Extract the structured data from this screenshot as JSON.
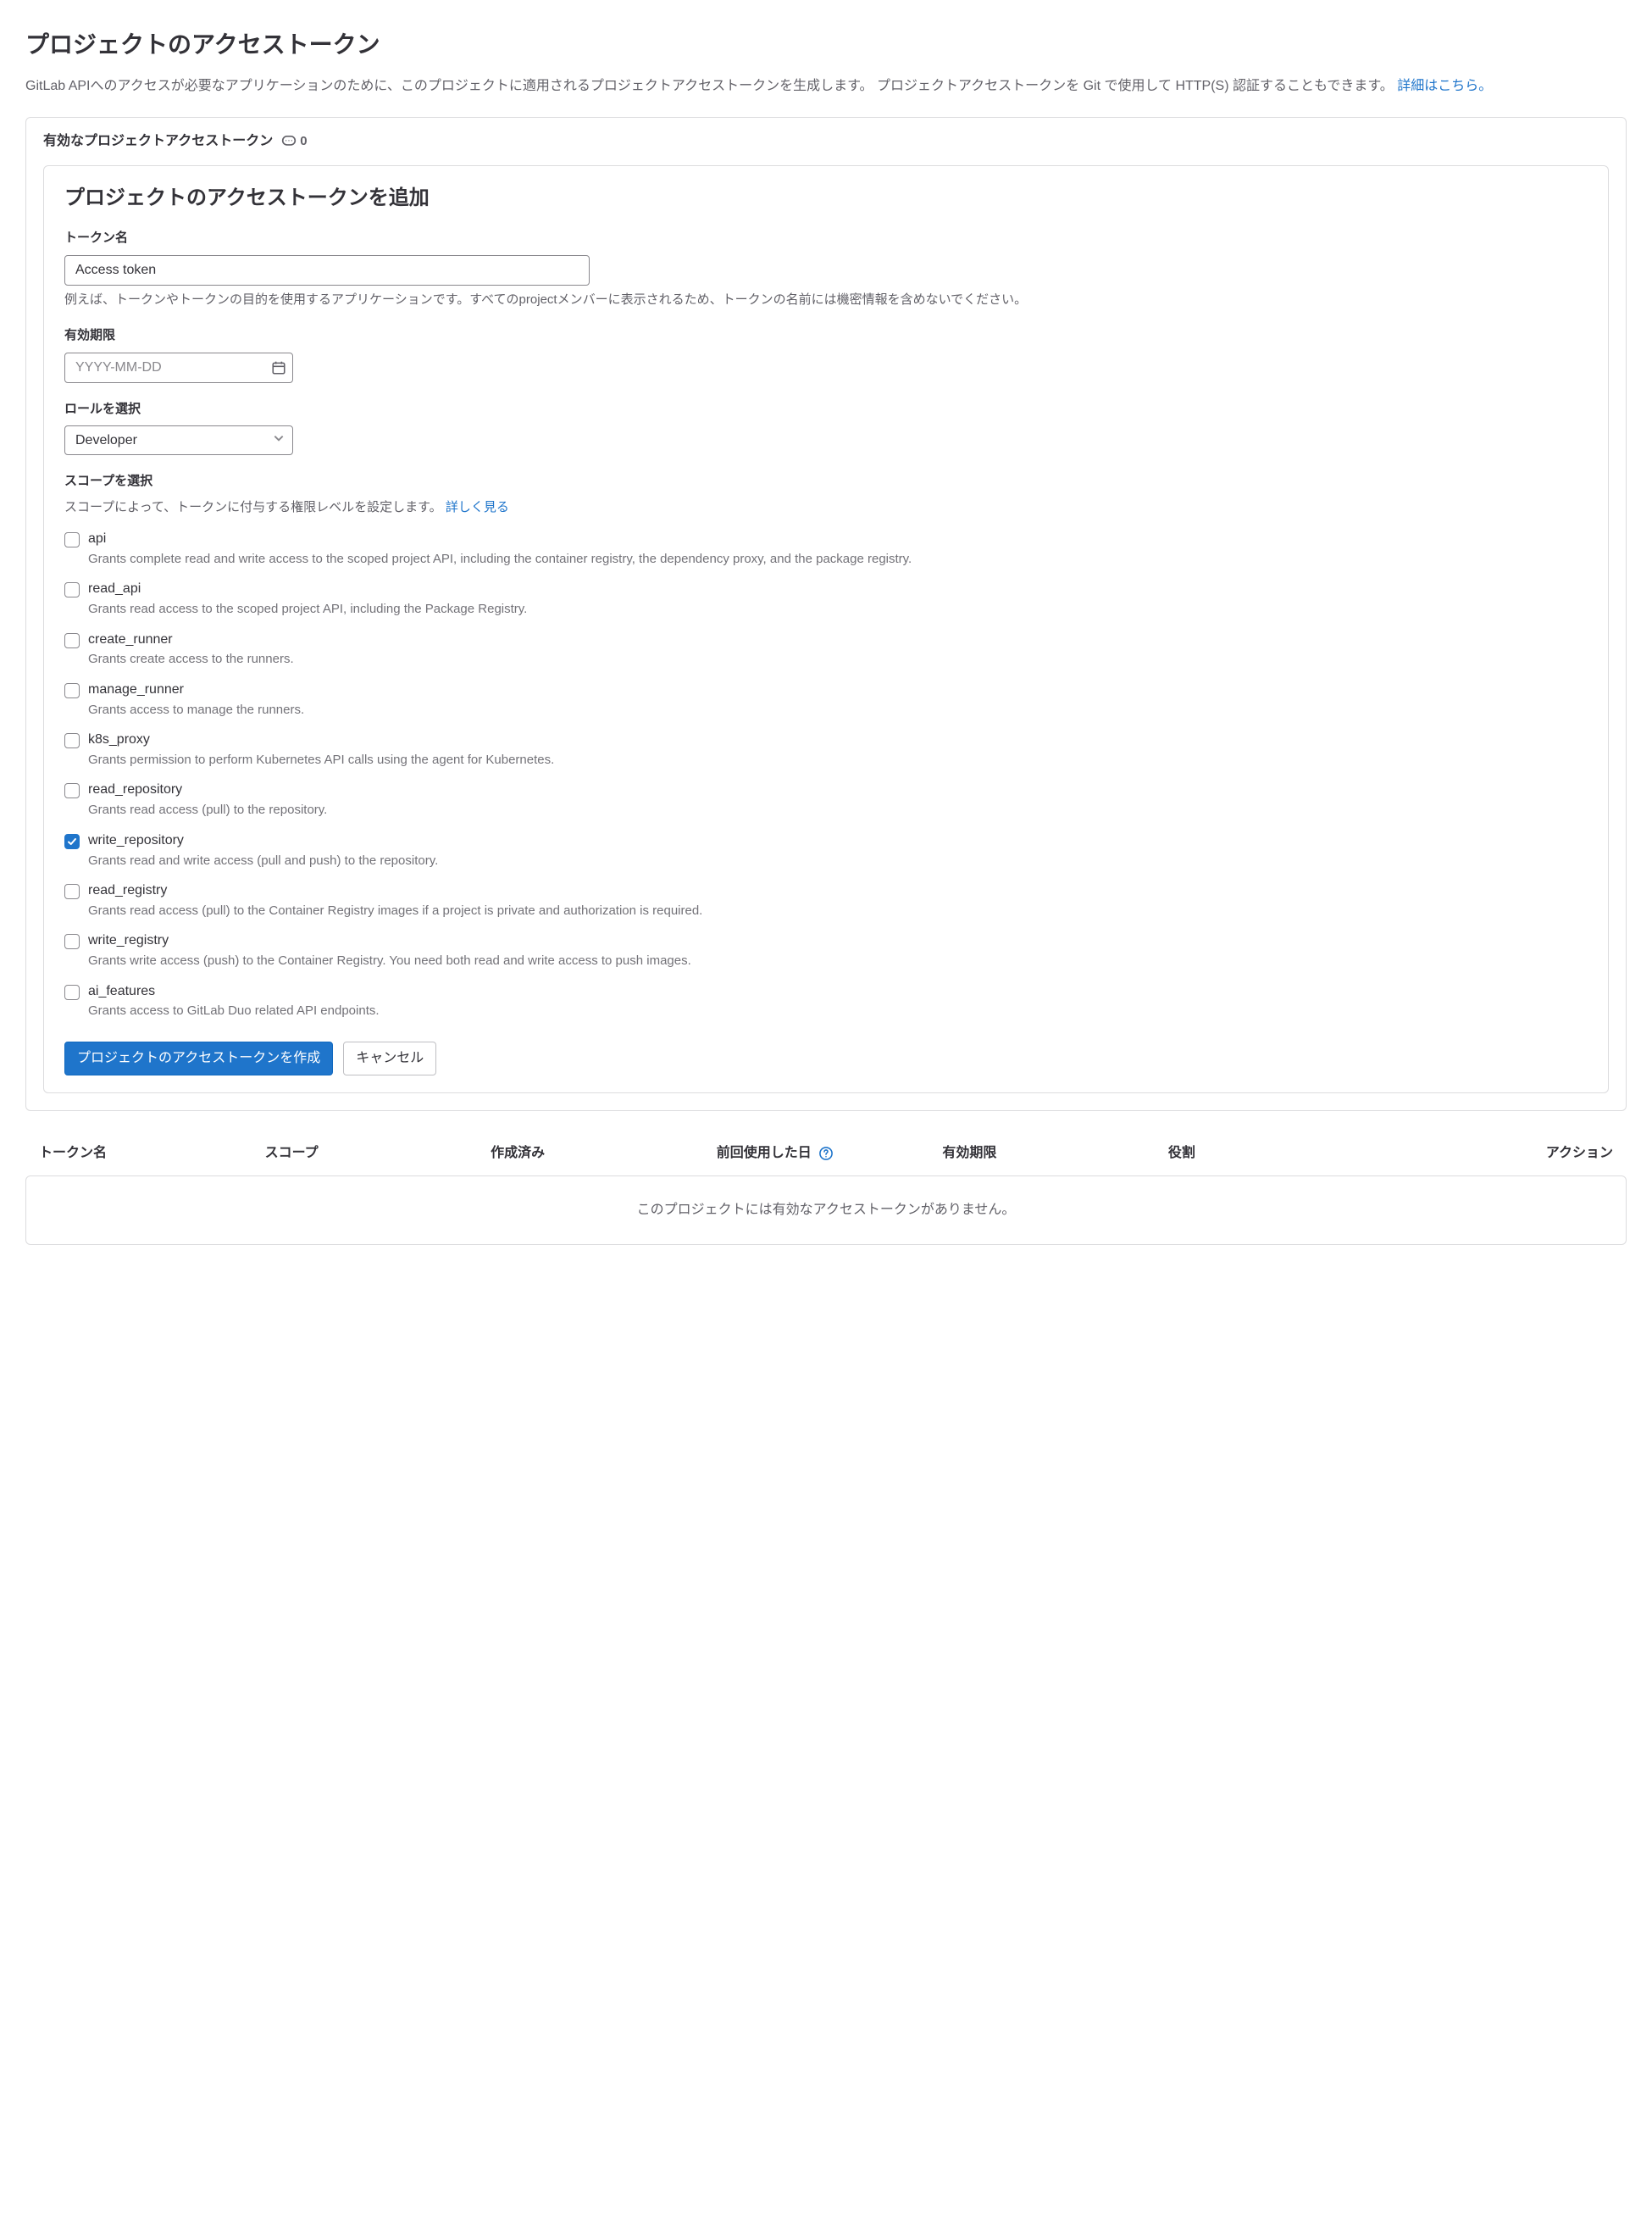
{
  "header": {
    "title": "プロジェクトのアクセストークン",
    "description_prefix": "GitLab APIへのアクセスが必要なアプリケーションのために、このプロジェクトに適用されるプロジェクトアクセストークンを生成します。 プロジェクトアクセストークンを Git で使用して HTTP(S) 認証することもできます。",
    "learn_more": "詳細はこちら。"
  },
  "active_tokens": {
    "title": "有効なプロジェクトアクセストークン",
    "count": "0"
  },
  "form": {
    "title": "プロジェクトのアクセストークンを追加",
    "name_label": "トークン名",
    "name_value": "Access token",
    "name_help": "例えば、トークンやトークンの目的を使用するアプリケーションです。すべてのprojectメンバーに表示されるため、トークンの名前には機密情報を含めないでください。",
    "expires_label": "有効期限",
    "expires_placeholder": "YYYY-MM-DD",
    "role_label": "ロールを選択",
    "role_value": "Developer",
    "scopes_label": "スコープを選択",
    "scopes_help_prefix": "スコープによって、トークンに付与する権限レベルを設定します。 ",
    "scopes_help_link": "詳しく見る",
    "scopes": [
      {
        "name": "api",
        "desc": "Grants complete read and write access to the scoped project API, including the container registry, the dependency proxy, and the package registry.",
        "checked": false
      },
      {
        "name": "read_api",
        "desc": "Grants read access to the scoped project API, including the Package Registry.",
        "checked": false
      },
      {
        "name": "create_runner",
        "desc": "Grants create access to the runners.",
        "checked": false
      },
      {
        "name": "manage_runner",
        "desc": "Grants access to manage the runners.",
        "checked": false
      },
      {
        "name": "k8s_proxy",
        "desc": "Grants permission to perform Kubernetes API calls using the agent for Kubernetes.",
        "checked": false
      },
      {
        "name": "read_repository",
        "desc": "Grants read access (pull) to the repository.",
        "checked": false
      },
      {
        "name": "write_repository",
        "desc": "Grants read and write access (pull and push) to the repository.",
        "checked": true
      },
      {
        "name": "read_registry",
        "desc": "Grants read access (pull) to the Container Registry images if a project is private and authorization is required.",
        "checked": false
      },
      {
        "name": "write_registry",
        "desc": "Grants write access (push) to the Container Registry. You need both read and write access to push images.",
        "checked": false
      },
      {
        "name": "ai_features",
        "desc": "Grants access to GitLab Duo related API endpoints.",
        "checked": false
      }
    ],
    "submit_label": "プロジェクトのアクセストークンを作成",
    "cancel_label": "キャンセル"
  },
  "table": {
    "columns": {
      "name": "トークン名",
      "scopes": "スコープ",
      "created": "作成済み",
      "last_used": "前回使用した日",
      "expires": "有効期限",
      "role": "役割",
      "action": "アクション"
    },
    "empty": "このプロジェクトには有効なアクセストークンがありません。"
  }
}
